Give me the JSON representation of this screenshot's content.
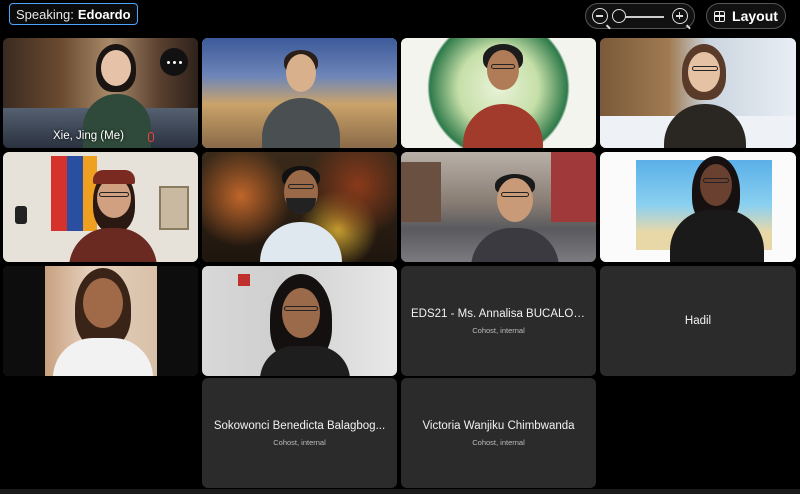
{
  "topbar": {
    "speaking_prefix": "Speaking:",
    "speaking_name": "Edoardo",
    "layout_label": "Layout",
    "zoom_out_icon": "zoom-out-icon",
    "zoom_in_icon": "zoom-in-icon",
    "zoom_level": 0
  },
  "tiles": {
    "self": {
      "name": "Xie, Jing (Me)"
    },
    "annalisa": {
      "name": "EDS21 - Ms. Annalisa BUCALOS...",
      "role": "Cohost, internal"
    },
    "hadil": {
      "name": "Hadil"
    },
    "sokowonci": {
      "name": "Sokowonci Benedicta Balagbog...",
      "role": "Cohost, internal"
    },
    "victoria": {
      "name": "Victoria Wanjiku Chimbwanda",
      "role": "Cohost, internal"
    }
  },
  "colors": {
    "background": "#000000",
    "empty_tile": "#2b2b2b",
    "speaking_border": "#4da3ff",
    "mic_muted": "#ff3b3b"
  }
}
